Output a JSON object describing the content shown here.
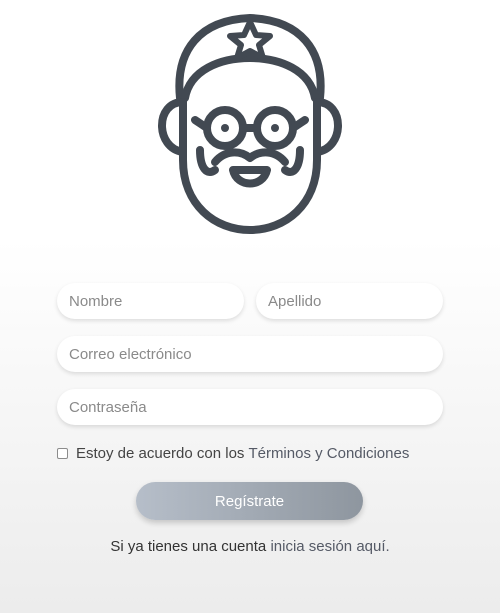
{
  "avatar": {
    "icon": "bearded-man-cap-icon",
    "stroke_color": "#424952"
  },
  "form": {
    "nombre_placeholder": "Nombre",
    "apellido_placeholder": "Apellido",
    "correo_placeholder": "Correo electrónico",
    "password_placeholder": "Contraseña",
    "terms_text": "Estoy de acuerdo con los",
    "terms_link": "Términos y Condiciones",
    "terms_checked": false,
    "submit_label": "Regístrate"
  },
  "footer": {
    "text": "Si ya tienes una cuenta",
    "login_link": "inicia sesión aquí."
  },
  "colors": {
    "button_gradient_start": "#b6bec9",
    "button_gradient_end": "#8e969f",
    "link": "#555a66"
  }
}
